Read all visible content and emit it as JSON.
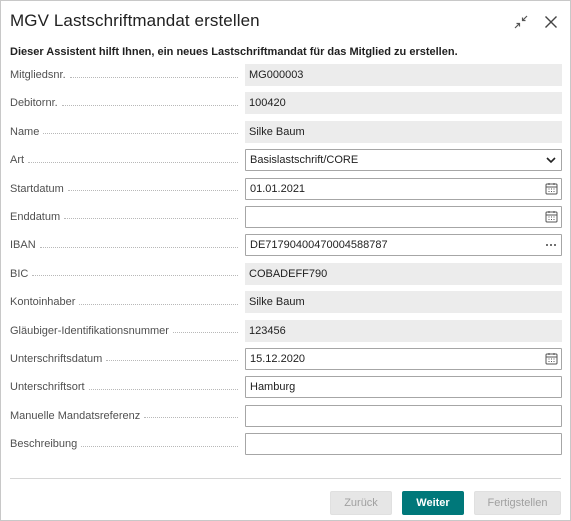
{
  "dialog": {
    "title": "MGV Lastschriftmandat erstellen",
    "intro": "Dieser Assistent hilft Ihnen, ein neues Lastschriftmandat für das Mitglied zu erstellen."
  },
  "fields": [
    {
      "label": "Mitgliedsnr.",
      "value": "MG000003",
      "kind": "readonly"
    },
    {
      "label": "Debitornr.",
      "value": "100420",
      "kind": "readonly"
    },
    {
      "label": "Name",
      "value": "Silke Baum",
      "kind": "readonly"
    },
    {
      "label": "Art",
      "value": "Basislastschrift/CORE",
      "kind": "select",
      "icon": "chevron-down-icon"
    },
    {
      "label": "Startdatum",
      "value": "01.01.2021",
      "kind": "date",
      "icon": "calendar-icon"
    },
    {
      "label": "Enddatum",
      "value": "",
      "kind": "date",
      "icon": "calendar-icon"
    },
    {
      "label": "IBAN",
      "value": "DE71790400470004588787",
      "kind": "lookup",
      "icon": "ellipsis-icon"
    },
    {
      "label": "BIC",
      "value": "COBADEFF790",
      "kind": "readonly"
    },
    {
      "label": "Kontoinhaber",
      "value": "Silke Baum",
      "kind": "readonly"
    },
    {
      "label": "Gläubiger-Identifikationsnummer",
      "value": "123456",
      "kind": "readonly"
    },
    {
      "label": "Unterschriftsdatum",
      "value": "15.12.2020",
      "kind": "date",
      "icon": "calendar-icon"
    },
    {
      "label": "Unterschriftsort",
      "value": "Hamburg",
      "kind": "text"
    },
    {
      "label": "Manuelle Mandatsreferenz",
      "value": "",
      "kind": "text"
    },
    {
      "label": "Beschreibung",
      "value": "",
      "kind": "text"
    }
  ],
  "footer": {
    "back_label": "Zurück",
    "next_label": "Weiter",
    "finish_label": "Fertigstellen"
  },
  "colors": {
    "primary": "#00787a",
    "readonly_bg": "#ececec"
  }
}
